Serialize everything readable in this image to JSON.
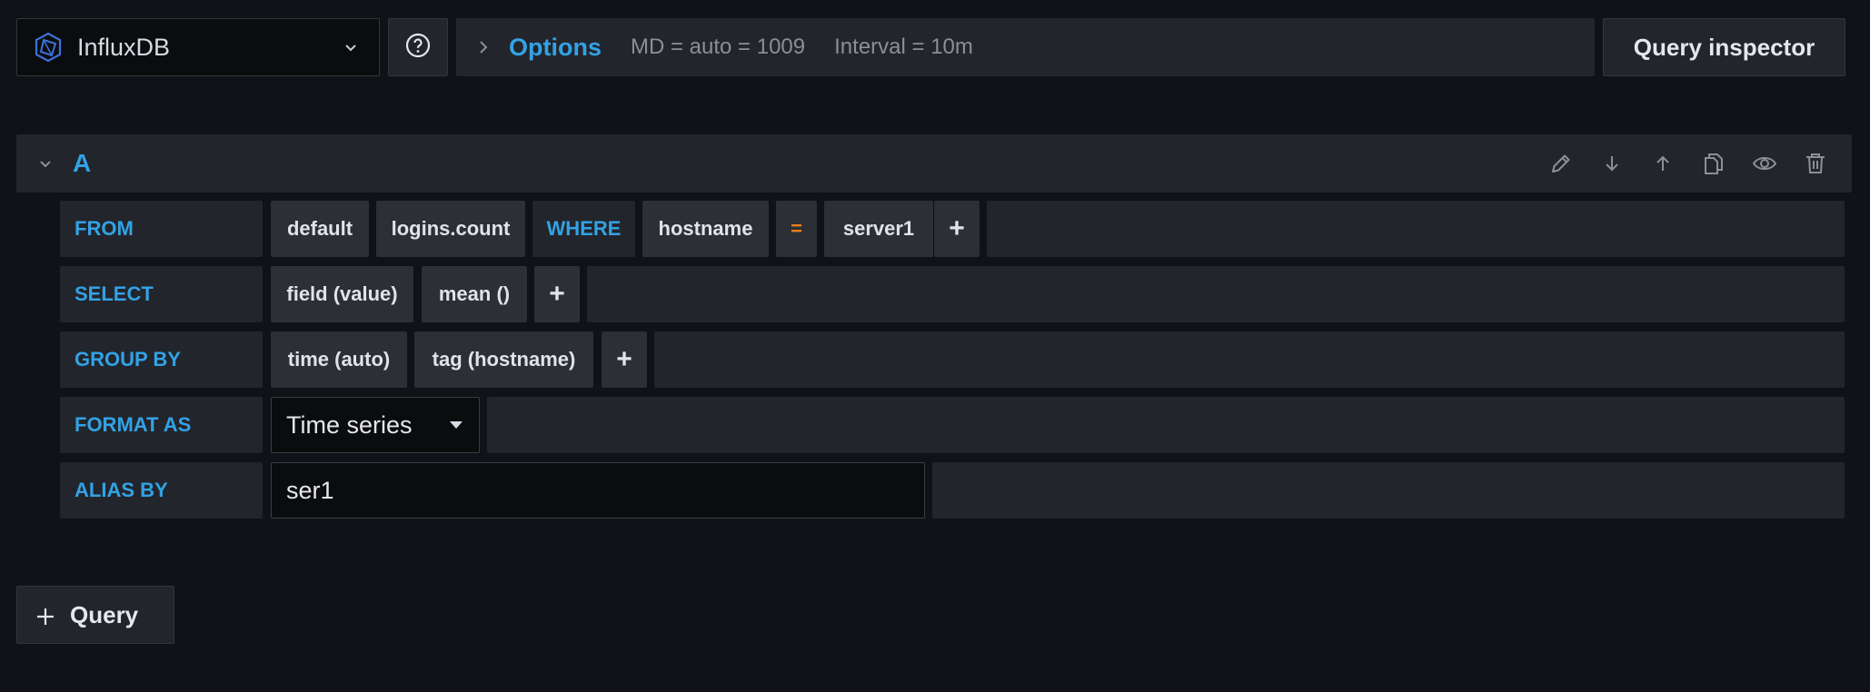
{
  "datasource": {
    "name": "InfluxDB",
    "icon": "influxdb-logo-icon"
  },
  "options": {
    "label": "Options",
    "max_data_points": "MD = auto = 1009",
    "interval": "Interval = 10m"
  },
  "query_inspector": {
    "label": "Query inspector"
  },
  "query": {
    "ref_id": "A",
    "actions": [
      "edit-icon",
      "move-down-icon",
      "move-up-icon",
      "duplicate-icon",
      "toggle-visibility-icon",
      "delete-icon"
    ],
    "from": {
      "label": "FROM",
      "policy": "default",
      "measurement": "logins.count",
      "where_label": "WHERE",
      "tag_key": "hostname",
      "operator": "=",
      "tag_value": "server1",
      "add": "+"
    },
    "select": {
      "label": "SELECT",
      "field": "field (value)",
      "aggregation": "mean ()",
      "add": "+"
    },
    "group_by": {
      "label": "GROUP BY",
      "time": "time (auto)",
      "tag": "tag (hostname)",
      "add": "+"
    },
    "format_as": {
      "label": "FORMAT AS",
      "value": "Time series"
    },
    "alias_by": {
      "label": "ALIAS BY",
      "value": "ser1"
    }
  },
  "add_query": {
    "label": "Query"
  },
  "colors": {
    "background": "#111217",
    "panel": "#22252b",
    "segment": "#2c2f35",
    "accent_blue": "#33a2e5",
    "operator_orange": "#eb7b18"
  }
}
